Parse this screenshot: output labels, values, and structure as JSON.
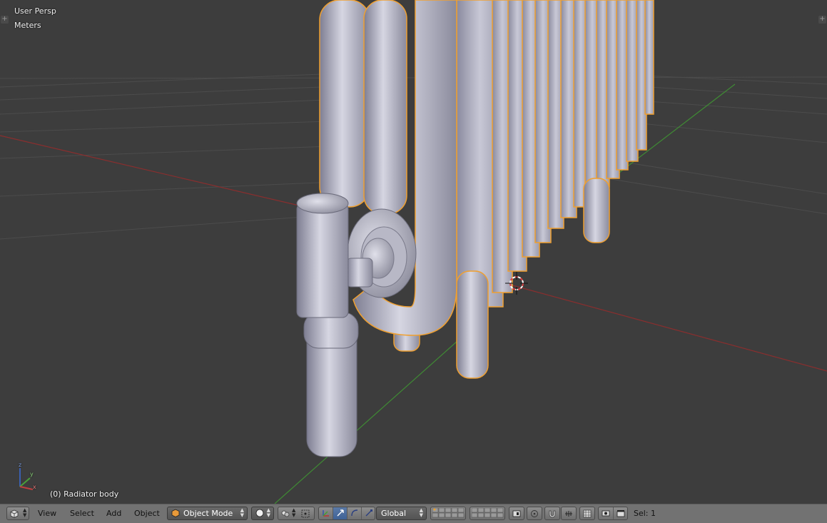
{
  "viewport": {
    "view_name": "User Persp",
    "units": "Meters",
    "active_object": "(0) Radiator body",
    "axis_labels": {
      "x": "x",
      "y": "y",
      "z": "z"
    }
  },
  "header": {
    "menus": {
      "view": "View",
      "select": "Select",
      "add": "Add",
      "object": "Object"
    },
    "mode": "Object Mode",
    "orientation": "Global",
    "selection": "Sel: 1"
  },
  "icons": {
    "editor_type": "cube-icon",
    "viewport_shading": "solid-sphere-icon",
    "pivot": "pivot-icon",
    "manipulator": "manipulator-axes-icon",
    "snap": "magnet-icon",
    "render": "camera-icon"
  },
  "colors": {
    "background": "#3d3d3d",
    "selection_outline": "#f0a030",
    "header": "#727272",
    "x_axis": "#a03030",
    "y_axis": "#4e9a3a",
    "active_button": "#4a6fa5"
  }
}
